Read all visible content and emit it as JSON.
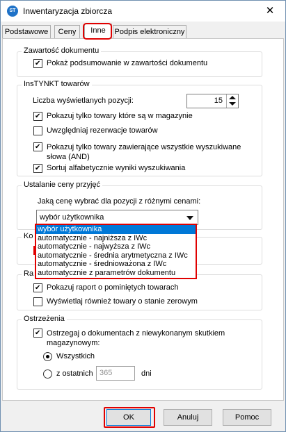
{
  "window": {
    "title": "Inwentaryzacja zbiorcza",
    "icon_text": "ST"
  },
  "tabs": [
    "Podstawowe",
    "Ceny",
    "Inne",
    "Podpis elektroniczny"
  ],
  "active_tab": "Inne",
  "groups": {
    "zawartosc": {
      "title": "Zawartość dokumentu",
      "show_summary": {
        "label": "Pokaż podsumowanie w zawartości dokumentu",
        "checked": true
      }
    },
    "instynkt": {
      "title": "InsTYNKT towarów",
      "count_label": "Liczba wyświetlanych pozycji:",
      "count_value": "15",
      "options": [
        {
          "label": "Pokazuj tylko towary które są w magazynie",
          "checked": true
        },
        {
          "label": "Uwzględniaj rezerwacje towarów",
          "checked": false
        },
        {
          "label": "Pokazuj tylko towary zawierające wszystkie wyszukiwane",
          "label2": "słowa (AND)",
          "checked": true
        },
        {
          "label": "Sortuj alfabetycznie wyniki wyszukiwania",
          "checked": true
        }
      ]
    },
    "cena": {
      "title": "Ustalanie ceny przyjęć",
      "question": "Jaką cenę wybrać dla pozycji z różnymi cenami:",
      "selected": "wybór użytkownika",
      "options": [
        "wybór użytkownika",
        "automatycznie - najniższa z IWc",
        "automatycznie - najwyższa z IWc",
        "automatycznie - średnia arytmetyczna z IWc",
        "automatycznie - średnioważona z IWc",
        "automatycznie z parametrów dokumentu"
      ]
    },
    "ko_partial": {
      "title": "Ko"
    },
    "raport": {
      "title": "Ra",
      "options": [
        {
          "label": "Pokazuj raport o pominiętych towarach",
          "checked": true
        },
        {
          "label": "Wyświetlaj również towary o stanie zerowym",
          "checked": false
        }
      ]
    },
    "ostrzezenia": {
      "title": "Ostrzeżenia",
      "warn": {
        "label": "Ostrzegaj o dokumentach z niewykonanym skutkiem",
        "label2": "magazynowym:",
        "checked": true
      },
      "radio_all": {
        "label": "Wszystkich",
        "checked": true
      },
      "radio_last": {
        "label": "z ostatnich",
        "checked": false
      },
      "days_value": "365",
      "days_unit": "dni"
    }
  },
  "buttons": {
    "ok": "OK",
    "cancel": "Anuluj",
    "help": "Pomoc"
  },
  "colors": {
    "highlight": "#e00000",
    "selection": "#0078d7"
  }
}
